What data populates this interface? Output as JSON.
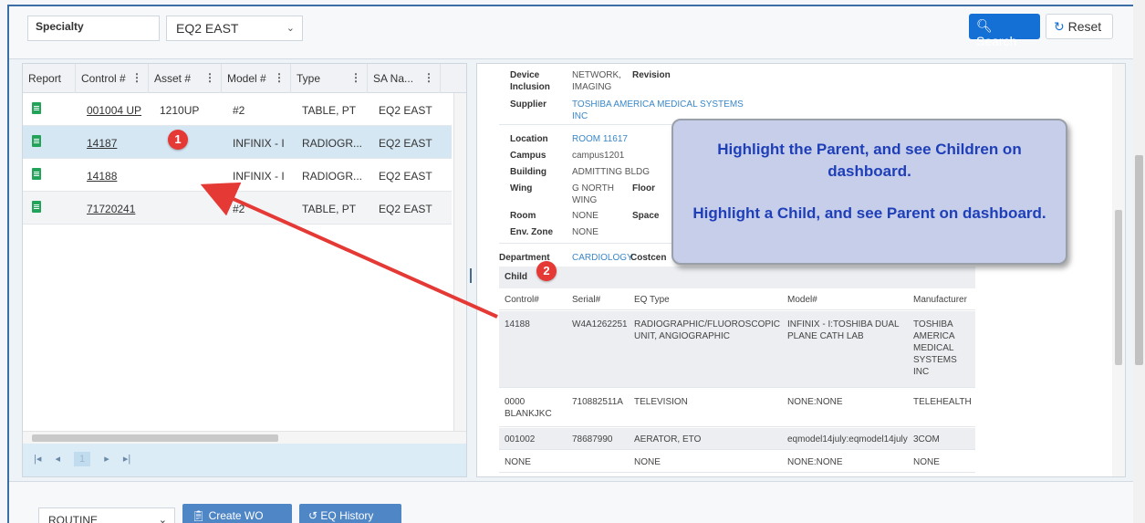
{
  "filters": {
    "specialty_label": "Specialty",
    "region_value": "EQ2 EAST"
  },
  "toolbar": {
    "search_label": "Search",
    "reset_label": "Reset"
  },
  "grid": {
    "columns": [
      "Report",
      "Control #",
      "Asset #",
      "Model #",
      "Type",
      "SA Na..."
    ],
    "rows": [
      {
        "control": "001004 UP",
        "asset": "1210UP",
        "model": "#2",
        "type": "TABLE, PT",
        "sa": "EQ2 EAST"
      },
      {
        "control": "14187",
        "asset": "",
        "model": "INFINIX - I",
        "type": "RADIOGR...",
        "sa": "EQ2 EAST"
      },
      {
        "control": "14188",
        "asset": "",
        "model": "INFINIX - I",
        "type": "RADIOGR...",
        "sa": "EQ2 EAST"
      },
      {
        "control": "71720241",
        "asset": "",
        "model": "#2",
        "type": "TABLE, PT",
        "sa": "EQ2 EAST"
      }
    ],
    "page_number": "1"
  },
  "badges": {
    "one": "1",
    "two": "2"
  },
  "detail": {
    "device_inclusion_label": "Device Inclusion",
    "device_inclusion_value": "NETWORK, IMAGING",
    "revision_label": "Revision",
    "supplier_label": "Supplier",
    "supplier_value": "TOSHIBA AMERICA MEDICAL SYSTEMS INC",
    "location_label": "Location",
    "location_value": "ROOM 11617",
    "campus_label": "Campus",
    "campus_value": "campus1201",
    "building_label": "Building",
    "building_value": "ADMITTING BLDG",
    "wing_label": "Wing",
    "wing_value": "G NORTH WING",
    "floor_label": "Floor",
    "room_label": "Room",
    "room_value": "NONE",
    "space_label": "Space",
    "envzone_label": "Env. Zone",
    "envzone_value": "NONE",
    "department_label": "Department",
    "department_value": "CARDIOLOGY",
    "costcen_label": "Costcen",
    "child_label": "Child",
    "child_columns": [
      "Control#",
      "Serial#",
      "EQ Type",
      "Model#",
      "Manufacturer"
    ],
    "child_rows": [
      {
        "control": "14188",
        "serial": "W4A1262251",
        "eqtype": "RADIOGRAPHIC/FLUOROSCOPIC UNIT, ANGIOGRAPHIC",
        "model": "INFINIX - I:TOSHIBA DUAL PLANE CATH LAB",
        "manufacturer": "TOSHIBA AMERICA MEDICAL SYSTEMS INC"
      },
      {
        "control": "0000 BLANKJKC",
        "serial": "710882511A",
        "eqtype": "TELEVISION",
        "model": "NONE:NONE",
        "manufacturer": "TELEHEALTH"
      },
      {
        "control": "001002",
        "serial": "78687990",
        "eqtype": "AERATOR, ETO",
        "model": "eqmodel14july:eqmodel14july",
        "manufacturer": "3COM"
      },
      {
        "control": "NONE",
        "serial": "",
        "eqtype": "NONE",
        "model": "NONE:NONE",
        "manufacturer": "NONE"
      }
    ]
  },
  "callout": {
    "line1": "Highlight the Parent, and see Children on dashboard.",
    "line2": "Highlight a Child, and see Parent on dashboard."
  },
  "actions": {
    "priority_value": "ROUTINE",
    "create_wo_label": "Create WO",
    "eq_history_label": "EQ History"
  },
  "colors": {
    "accent": "#1570d6",
    "badge": "#e53935",
    "arrow": "#e53935",
    "callout_text": "#1f3fb8"
  }
}
